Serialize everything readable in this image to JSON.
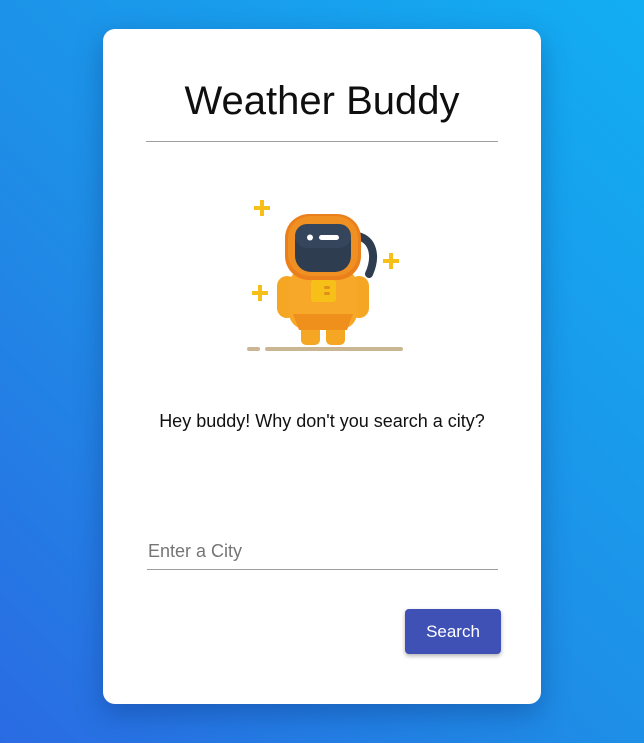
{
  "app": {
    "title": "Weather Buddy"
  },
  "main": {
    "message": "Hey buddy! Why don't you search a city?",
    "illustration_icon": "astronaut-icon"
  },
  "search": {
    "placeholder": "Enter a City",
    "value": "",
    "button_label": "Search"
  },
  "colors": {
    "background_start": "#2a6be3",
    "background_end": "#12aef3",
    "button": "#3f51b5",
    "astronaut_suit": "#f5a623",
    "visor": "#2f3d50",
    "sparkle": "#f6c018",
    "ground": "#cbb693"
  }
}
